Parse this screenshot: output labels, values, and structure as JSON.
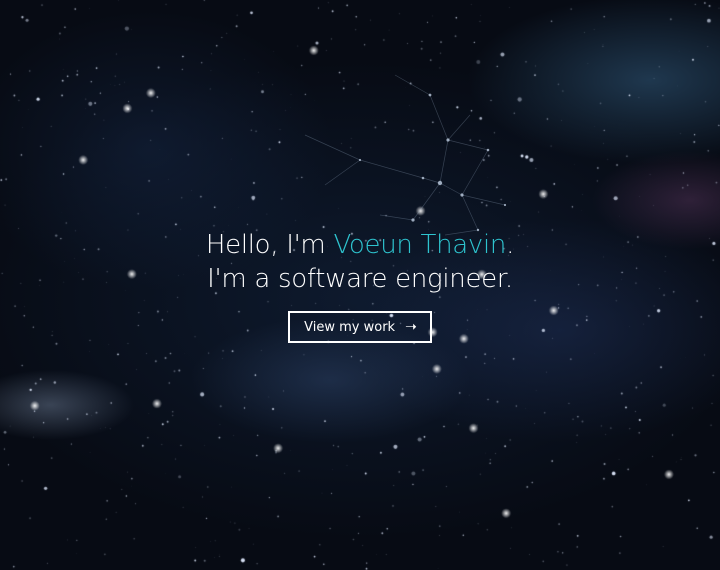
{
  "hero": {
    "greeting_prefix": "Hello, I'm ",
    "name": "Voeun Thavin",
    "greeting_suffix": ".",
    "tagline": "I'm a software engineer.",
    "cta_label": "View my work",
    "cta_icon": "arrow-right-icon"
  },
  "colors": {
    "accent": "#2ec4cf",
    "text": "#ffffff",
    "background": "#070b14"
  }
}
